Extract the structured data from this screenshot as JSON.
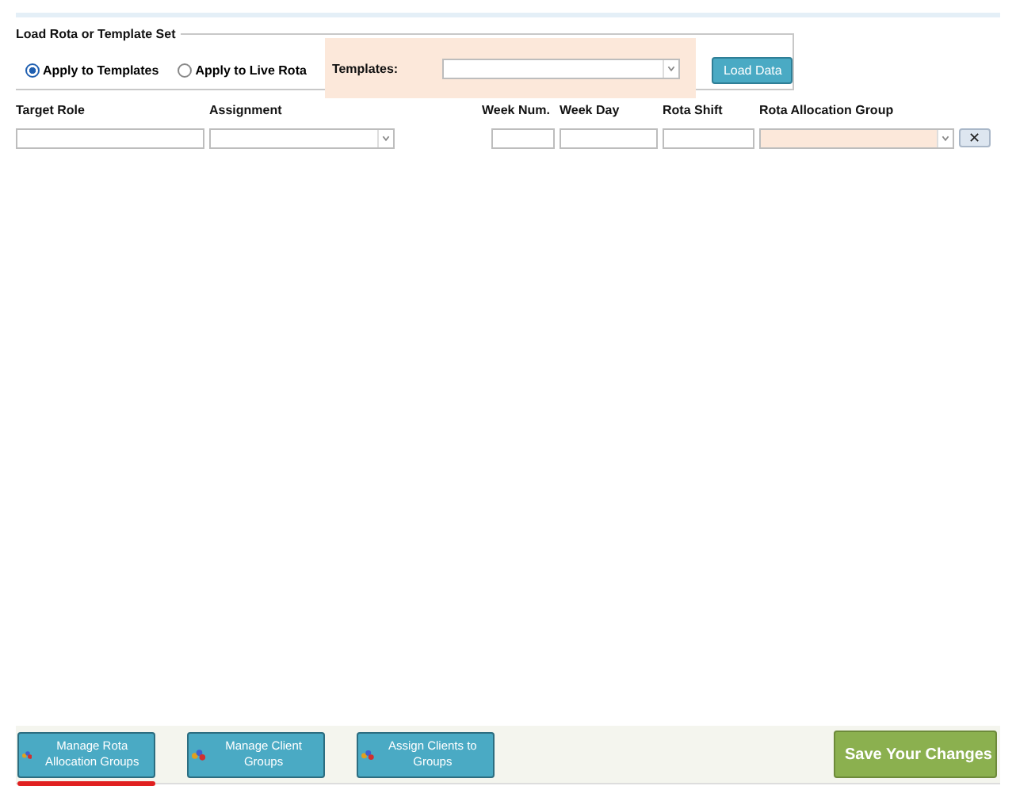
{
  "load_panel": {
    "legend": "Load Rota or Template Set",
    "options": [
      {
        "label": "Apply to Templates",
        "selected": true
      },
      {
        "label": "Apply to Live Rota",
        "selected": false
      }
    ],
    "templates_label": "Templates:",
    "load_button": "Load Data"
  },
  "filters": {
    "columns": [
      {
        "label": "Target Role",
        "kind": "text"
      },
      {
        "label": "Assignment",
        "kind": "select"
      },
      {
        "label": "Week Num.",
        "kind": "text"
      },
      {
        "label": "Week Day",
        "kind": "text"
      },
      {
        "label": "Rota Shift",
        "kind": "text"
      },
      {
        "label": "Rota Allocation Group",
        "kind": "select"
      }
    ],
    "clear_button": "✕"
  },
  "footer": {
    "buttons": [
      {
        "label": "Manage Rota Allocation Groups",
        "selected": true
      },
      {
        "label": "Manage Client Groups",
        "selected": false
      },
      {
        "label": "Assign Clients to Groups",
        "selected": false
      }
    ],
    "save_button": "Save Your Changes"
  }
}
